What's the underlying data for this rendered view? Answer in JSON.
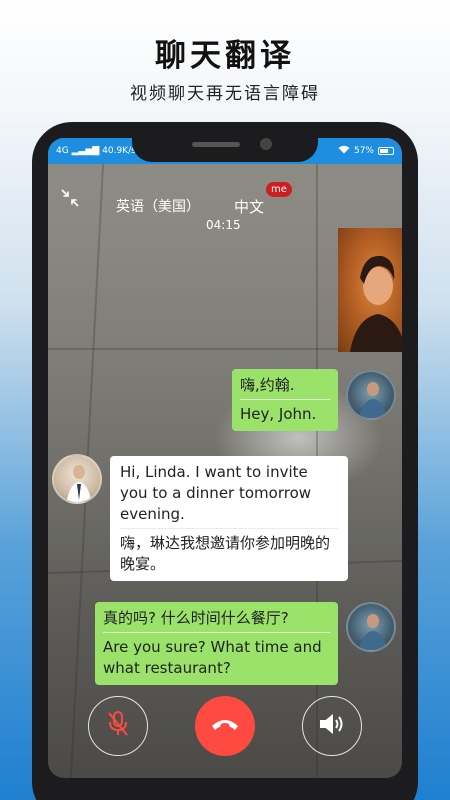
{
  "promo": {
    "title": "聊天翻译",
    "subtitle": "视频聊天再无语言障碍"
  },
  "status_bar": {
    "network": "4G",
    "speed": "40.9K/s",
    "battery": "57%"
  },
  "call": {
    "source_language": "英语（美国）",
    "target_language": "中文",
    "me_badge": "me",
    "timer": "04:15"
  },
  "messages": [
    {
      "side": "right",
      "original": "嗨,约翰.",
      "translation": "Hey, John."
    },
    {
      "side": "left",
      "original": "Hi, Linda. I want to invite you to a dinner tomorrow evening.",
      "translation": "嗨，琳达我想邀请你参加明晚的晚宴。"
    },
    {
      "side": "right",
      "original": "真的吗? 什么时间什么餐厅?",
      "translation": "Are you sure? What time and what restaurant?"
    }
  ],
  "controls": {
    "mute_icon": "mic-off-icon",
    "hangup_icon": "phone-hangup-icon",
    "speaker_icon": "speaker-icon"
  },
  "colors": {
    "status_bar": "#1e8fe0",
    "bubble_green": "#9be26a",
    "hangup_red": "#ff4a41",
    "me_badge": "#cc1f1f"
  }
}
